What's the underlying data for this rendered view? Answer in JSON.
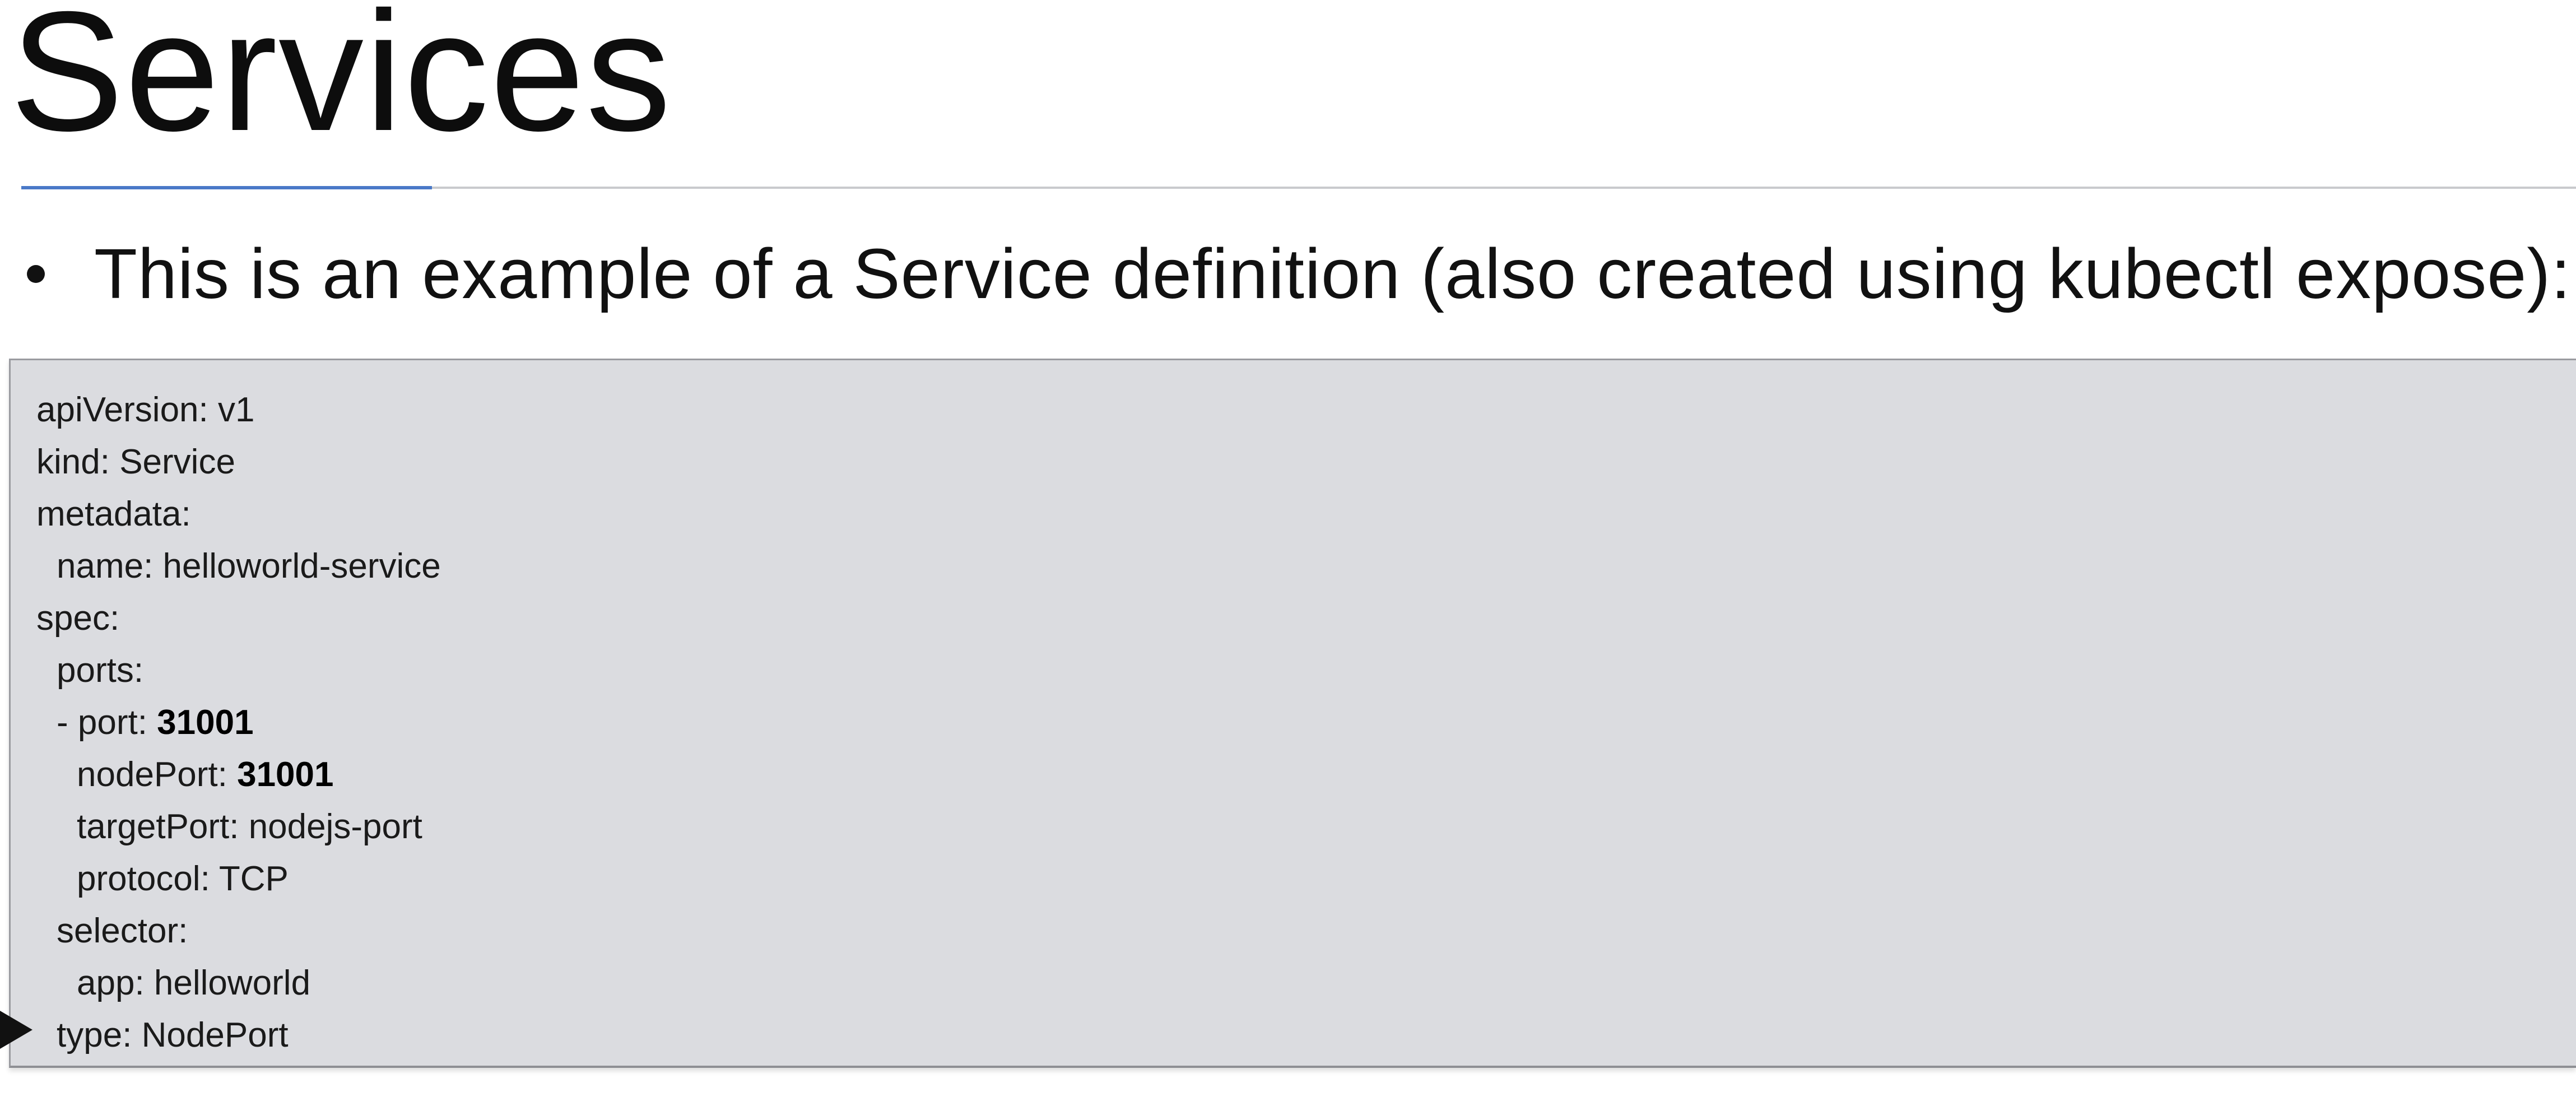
{
  "slide": {
    "title": "Services",
    "bullet": "This is an example of a Service definition (also created using kubectl expose):"
  },
  "code": {
    "lines": [
      {
        "key": "apiVersion: ",
        "value": "v1"
      },
      {
        "key": "kind: ",
        "value": "Service"
      },
      {
        "key": "metadata:",
        "value": ""
      },
      {
        "key": "name: ",
        "value": "helloworld-service"
      },
      {
        "key": "spec:",
        "value": ""
      },
      {
        "key": "ports:",
        "value": ""
      },
      {
        "key": "- port: ",
        "value": "31001"
      },
      {
        "key": "nodePort: ",
        "value": "31001"
      },
      {
        "key": "targetPort: ",
        "value": "nodejs-port"
      },
      {
        "key": "protocol: ",
        "value": "TCP"
      },
      {
        "key": "selector:",
        "value": ""
      },
      {
        "key": "app: ",
        "value": "helloworld"
      },
      {
        "key": "type: ",
        "value": "NodePort"
      }
    ]
  },
  "icons": {
    "pointer": "pointer-arrow-icon"
  },
  "colors": {
    "accent_rule": "#4a79c8",
    "code_background": "#dbdce0"
  }
}
